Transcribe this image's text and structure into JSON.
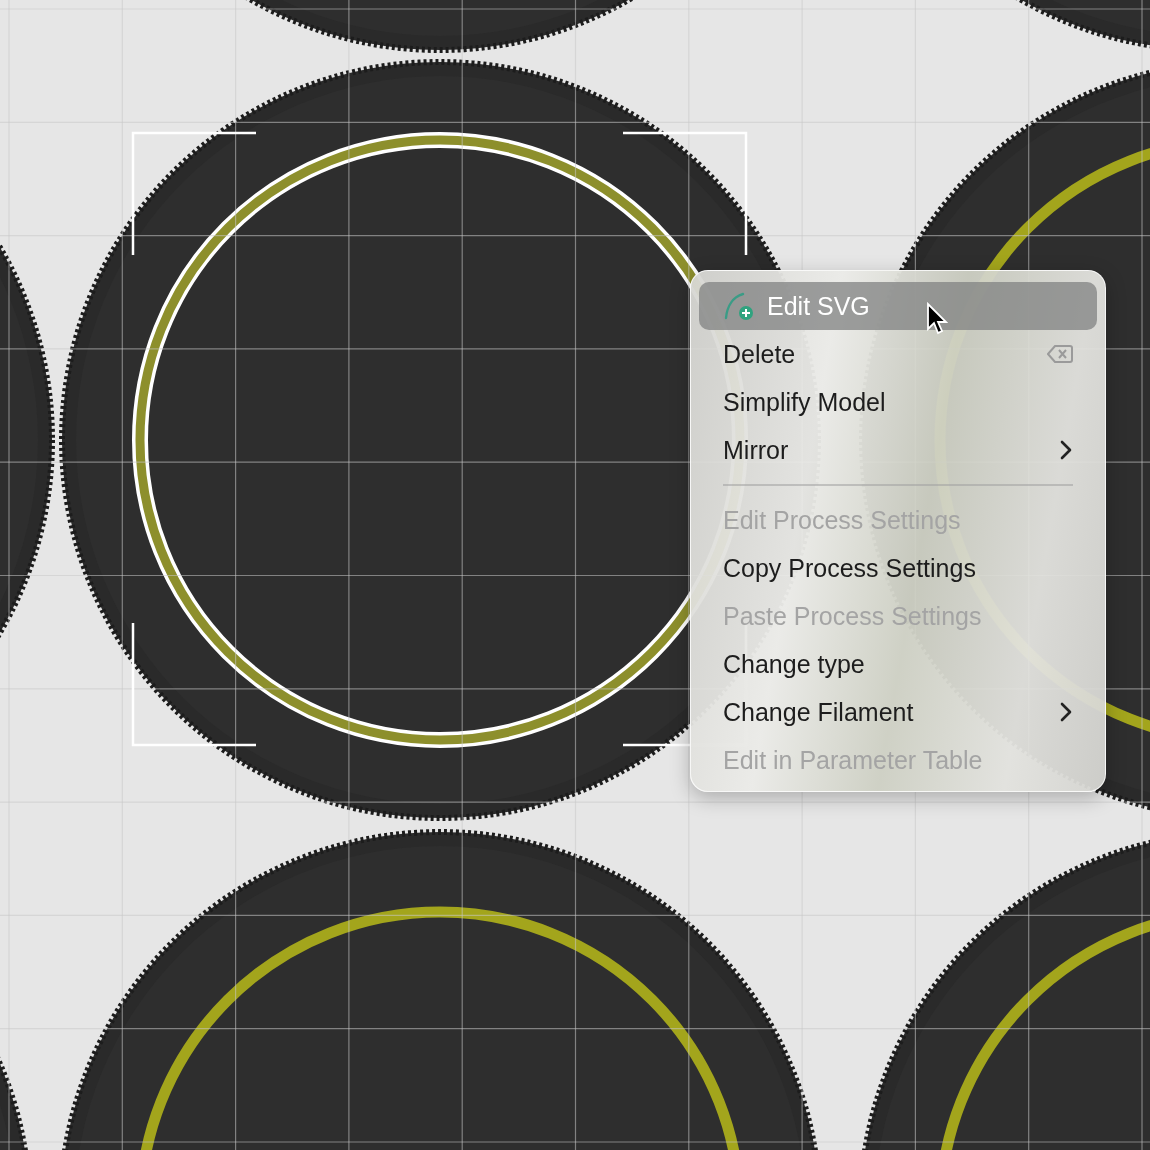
{
  "context_menu": {
    "items": [
      {
        "kind": "icon-item",
        "label": "Edit SVG",
        "selected": true,
        "disabled": false,
        "submenu": false
      },
      {
        "kind": "shortcut-item",
        "label": "Delete",
        "selected": false,
        "disabled": false,
        "submenu": false
      },
      {
        "kind": "item",
        "label": "Simplify Model",
        "selected": false,
        "disabled": false,
        "submenu": false
      },
      {
        "kind": "item",
        "label": "Mirror",
        "selected": false,
        "disabled": false,
        "submenu": true
      },
      {
        "kind": "separator"
      },
      {
        "kind": "item",
        "label": "Edit Process Settings",
        "selected": false,
        "disabled": true,
        "submenu": false
      },
      {
        "kind": "item",
        "label": "Copy Process Settings",
        "selected": false,
        "disabled": false,
        "submenu": false
      },
      {
        "kind": "item",
        "label": "Paste Process Settings",
        "selected": false,
        "disabled": true,
        "submenu": false
      },
      {
        "kind": "item",
        "label": "Change type",
        "selected": false,
        "disabled": false,
        "submenu": false
      },
      {
        "kind": "item",
        "label": "Change Filament",
        "selected": false,
        "disabled": false,
        "submenu": true
      },
      {
        "kind": "item",
        "label": "Edit in Parameter Table",
        "selected": false,
        "disabled": true,
        "submenu": false
      }
    ]
  }
}
